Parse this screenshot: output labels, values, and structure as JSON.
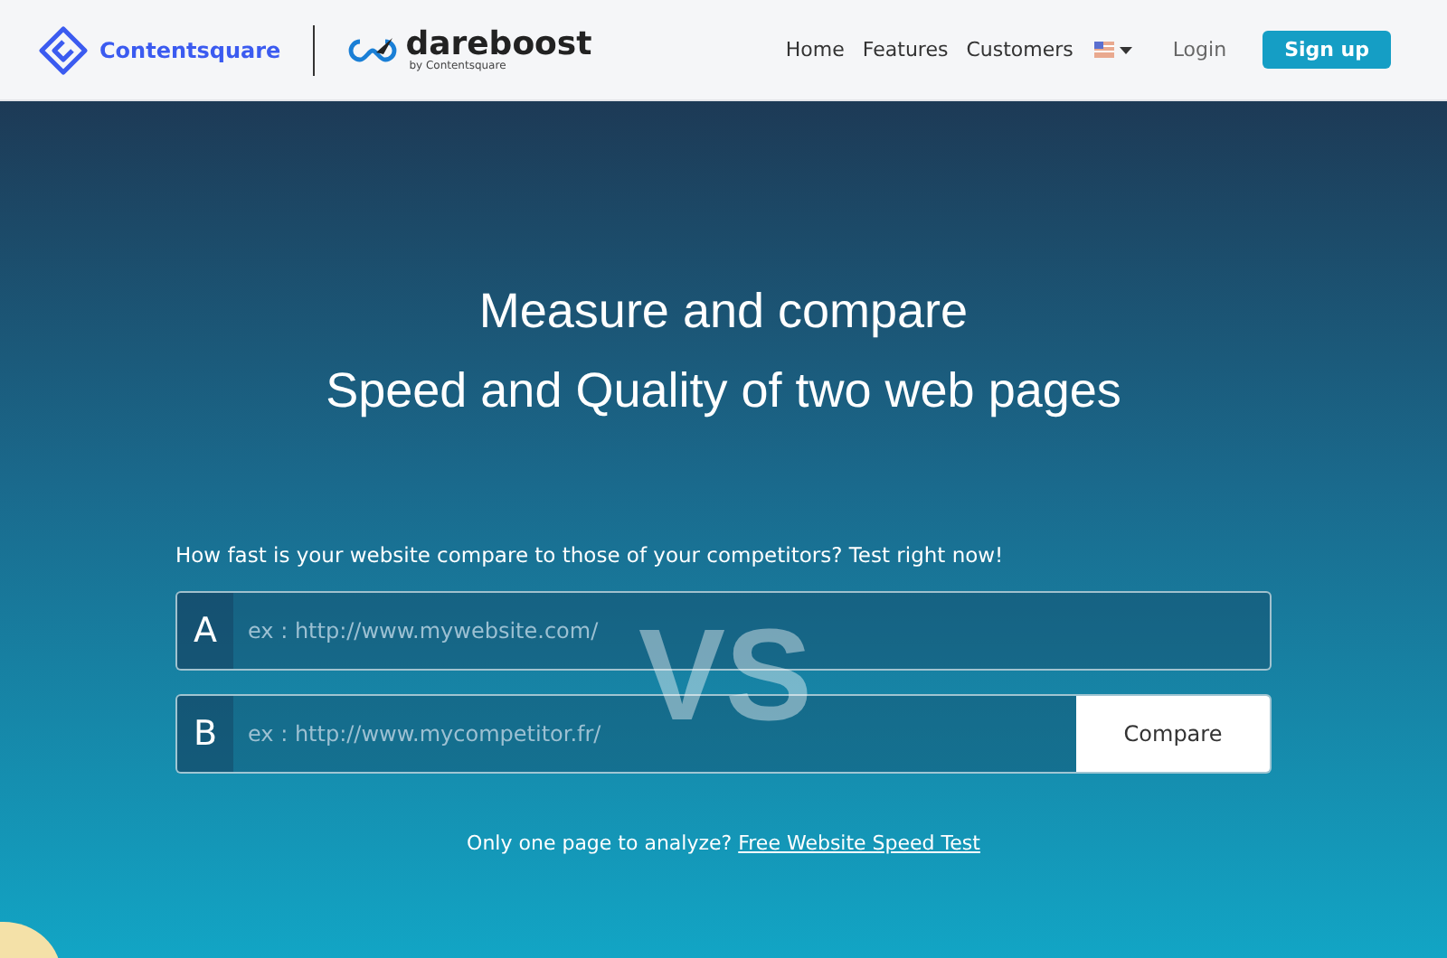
{
  "header": {
    "brand": "Contentsquare",
    "product": "dareboost",
    "product_sub": "by Contentsquare",
    "nav": [
      {
        "label": "Home"
      },
      {
        "label": "Features"
      },
      {
        "label": "Customers"
      }
    ],
    "login": "Login",
    "signup": "Sign up"
  },
  "hero": {
    "title_lines": [
      "Measure and compare",
      "Speed and Quality of two web pages"
    ],
    "question": "How fast is your website compare to those of your competitors? Test right now!",
    "vs": "VS",
    "fields": [
      {
        "letter": "A",
        "placeholder": "ex : http://www.mywebsite.com/"
      },
      {
        "letter": "B",
        "placeholder": "ex : http://www.mycompetitor.fr/"
      }
    ],
    "compare": "Compare",
    "footer_text": "Only one page to analyze?",
    "footer_link": "Free Website Speed Test"
  }
}
